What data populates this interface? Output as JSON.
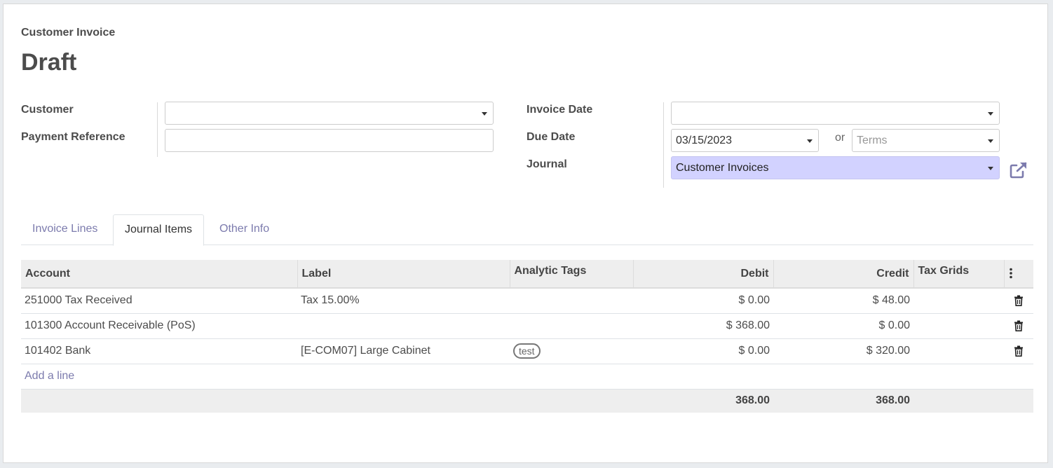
{
  "header": {
    "doc_type": "Customer Invoice",
    "state": "Draft"
  },
  "form": {
    "customer_label": "Customer",
    "customer_value": "",
    "payment_reference_label": "Payment Reference",
    "payment_reference_value": "",
    "invoice_date_label": "Invoice Date",
    "invoice_date_value": "",
    "due_date_label": "Due Date",
    "due_date_value": "03/15/2023",
    "or_text": "or",
    "terms_placeholder": "Terms",
    "journal_label": "Journal",
    "journal_value": "Customer Invoices",
    "journal_highlight_color": "#d2d2ff"
  },
  "tabs": [
    {
      "label": "Invoice Lines",
      "active": false
    },
    {
      "label": "Journal Items",
      "active": true
    },
    {
      "label": "Other Info",
      "active": false
    }
  ],
  "table": {
    "columns": [
      "Account",
      "Label",
      "Analytic Tags",
      "Debit",
      "Credit",
      "Tax Grids"
    ],
    "rows": [
      {
        "account": "251000 Tax Received",
        "label": "Tax 15.00%",
        "tag": "",
        "debit": "$ 0.00",
        "credit": "$ 48.00",
        "tax_grids": ""
      },
      {
        "account": "101300 Account Receivable (PoS)",
        "label": "",
        "tag": "",
        "debit": "$ 368.00",
        "credit": "$ 0.00",
        "tax_grids": ""
      },
      {
        "account": "101402 Bank",
        "label": "[E-COM07] Large Cabinet",
        "tag": "test",
        "debit": "$ 0.00",
        "credit": "$ 320.00",
        "tax_grids": ""
      }
    ],
    "add_line": "Add a line",
    "totals": {
      "debit": "368.00",
      "credit": "368.00"
    }
  },
  "colors": {
    "accent": "#7c7bad",
    "header_bg": "#eeeeee"
  },
  "icons": {
    "external_link": "external-link-icon",
    "delete": "trash-icon",
    "column_options": "kebab-menu-icon",
    "dropdown": "caret-down-icon"
  }
}
